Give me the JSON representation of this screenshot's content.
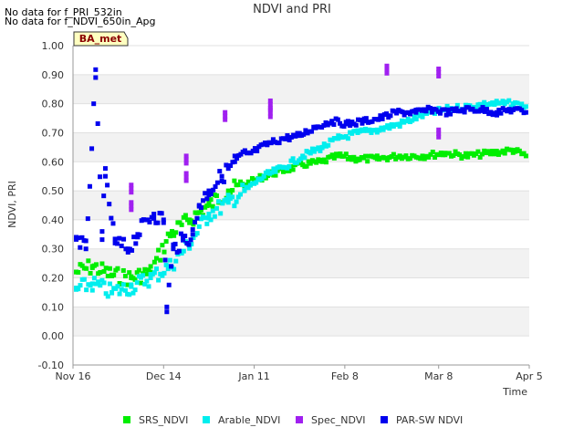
{
  "notes": [
    "No data for f_PRI_532in",
    "No data for f_NDVI_650in_Apg"
  ],
  "chart_data": {
    "type": "scatter",
    "title": "NDVI and PRI",
    "xlabel": "Time",
    "ylabel": "NDVI, PRI",
    "badge": "BA_met",
    "xlim": [
      "2023-11-16",
      "2024-04-05"
    ],
    "ylim": [
      -0.1,
      1.0
    ],
    "x_ticks": [
      {
        "date": "2023-11-16",
        "label": "Nov 16"
      },
      {
        "date": "2023-12-14",
        "label": "Dec 14"
      },
      {
        "date": "2024-01-11",
        "label": "Jan 11"
      },
      {
        "date": "2024-02-08",
        "label": "Feb 8"
      },
      {
        "date": "2024-03-08",
        "label": "Mar 8"
      },
      {
        "date": "2024-04-05",
        "label": "Apr 5"
      }
    ],
    "y_ticks": [
      "-0.10",
      "0.00",
      "0.10",
      "0.20",
      "0.30",
      "0.40",
      "0.50",
      "0.60",
      "0.70",
      "0.80",
      "0.90",
      "1.00"
    ],
    "grid": "horizontal alternating bands",
    "legend_position": "bottom",
    "series": [
      {
        "name": "SRS_NDVI",
        "color": "#00ee00",
        "x": [
          "2023-11-17",
          "2023-11-22",
          "2023-11-28",
          "2023-12-04",
          "2023-12-10",
          "2023-12-16",
          "2023-12-22",
          "2023-12-28",
          "2024-01-03",
          "2024-01-08",
          "2024-01-14",
          "2024-01-20",
          "2024-01-26",
          "2024-02-01",
          "2024-02-06",
          "2024-02-12",
          "2024-02-18",
          "2024-02-25",
          "2024-03-03",
          "2024-03-10",
          "2024-03-17",
          "2024-03-24",
          "2024-03-31",
          "2024-04-04"
        ],
        "y": [
          0.22,
          0.24,
          0.21,
          0.2,
          0.22,
          0.35,
          0.4,
          0.45,
          0.5,
          0.52,
          0.55,
          0.57,
          0.59,
          0.6,
          0.62,
          0.61,
          0.61,
          0.62,
          0.62,
          0.63,
          0.62,
          0.63,
          0.64,
          0.62
        ]
      },
      {
        "name": "Arable_NDVI",
        "color": "#00eeee",
        "x": [
          "2023-11-17",
          "2023-11-22",
          "2023-11-28",
          "2023-12-04",
          "2023-12-10",
          "2023-12-16",
          "2023-12-22",
          "2023-12-28",
          "2024-01-03",
          "2024-01-08",
          "2024-01-14",
          "2024-01-20",
          "2024-01-26",
          "2024-02-01",
          "2024-02-06",
          "2024-02-12",
          "2024-02-18",
          "2024-02-25",
          "2024-03-03",
          "2024-03-10",
          "2024-03-17",
          "2024-03-24",
          "2024-03-31",
          "2024-04-04"
        ],
        "y": [
          0.16,
          0.18,
          0.15,
          0.17,
          0.2,
          0.24,
          0.32,
          0.42,
          0.46,
          0.5,
          0.55,
          0.58,
          0.62,
          0.65,
          0.68,
          0.7,
          0.71,
          0.73,
          0.76,
          0.78,
          0.79,
          0.8,
          0.8,
          0.79
        ]
      },
      {
        "name": "Spec_NDVI",
        "color": "#a020f0",
        "x": [
          "2023-12-04",
          "2023-12-04",
          "2023-12-21",
          "2023-12-21",
          "2024-01-02",
          "2024-01-16",
          "2024-01-16",
          "2024-02-21",
          "2024-03-08",
          "2024-03-08"
        ],
        "y": [
          0.52,
          0.46,
          0.62,
          0.56,
          0.77,
          0.81,
          0.78,
          0.93,
          0.92,
          0.71
        ]
      },
      {
        "name": "PAR-SW NDVI",
        "color": "#0000ee",
        "x": [
          "2023-11-17",
          "2023-11-20",
          "2023-11-23",
          "2023-11-25",
          "2023-11-26",
          "2023-11-29",
          "2023-12-03",
          "2023-12-06",
          "2023-12-09",
          "2023-12-11",
          "2023-12-14",
          "2023-12-15",
          "2023-12-17",
          "2023-12-20",
          "2023-12-23",
          "2023-12-25",
          "2023-12-28",
          "2024-01-01",
          "2024-01-05",
          "2024-01-10",
          "2024-01-15",
          "2024-01-20",
          "2024-01-25",
          "2024-01-30",
          "2024-02-04",
          "2024-02-09",
          "2024-02-14",
          "2024-02-19",
          "2024-02-24",
          "2024-03-01",
          "2024-03-06",
          "2024-03-11",
          "2024-03-16",
          "2024-03-21",
          "2024-03-26",
          "2024-03-31",
          "2024-04-04"
        ],
        "y": [
          0.34,
          0.3,
          0.89,
          0.36,
          0.55,
          0.32,
          0.3,
          0.35,
          0.4,
          0.42,
          0.4,
          0.1,
          0.3,
          0.33,
          0.35,
          0.45,
          0.5,
          0.55,
          0.6,
          0.63,
          0.66,
          0.68,
          0.69,
          0.72,
          0.74,
          0.73,
          0.74,
          0.75,
          0.77,
          0.77,
          0.78,
          0.77,
          0.78,
          0.78,
          0.77,
          0.78,
          0.77
        ]
      }
    ]
  }
}
